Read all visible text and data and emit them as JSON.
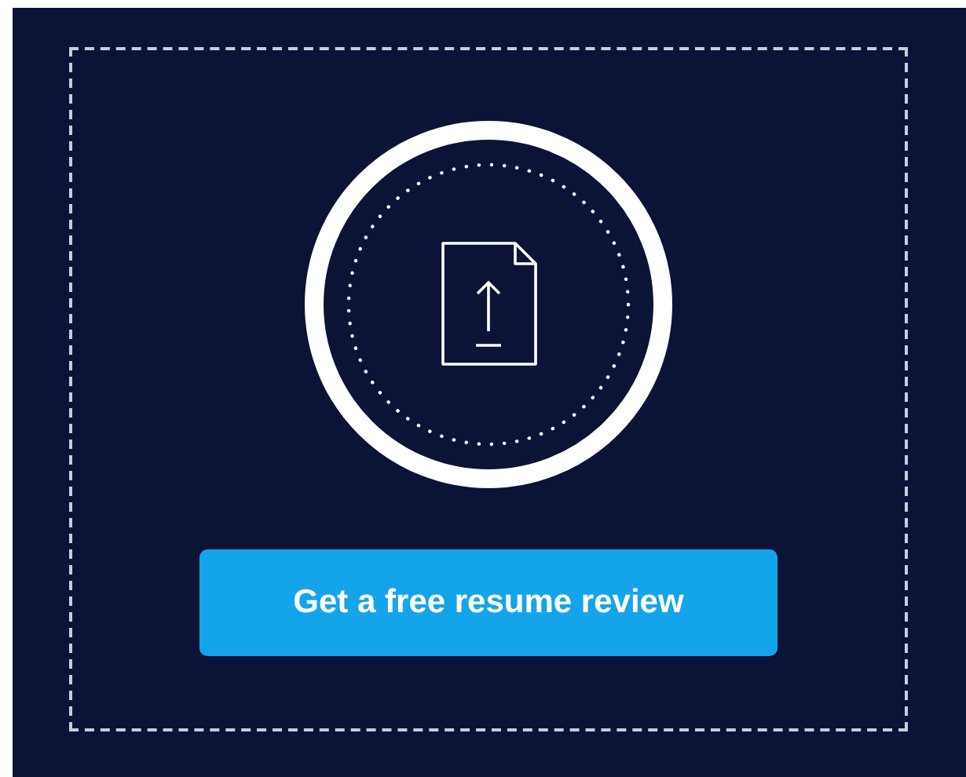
{
  "upload_button": {
    "label": "Get a free resume review"
  }
}
